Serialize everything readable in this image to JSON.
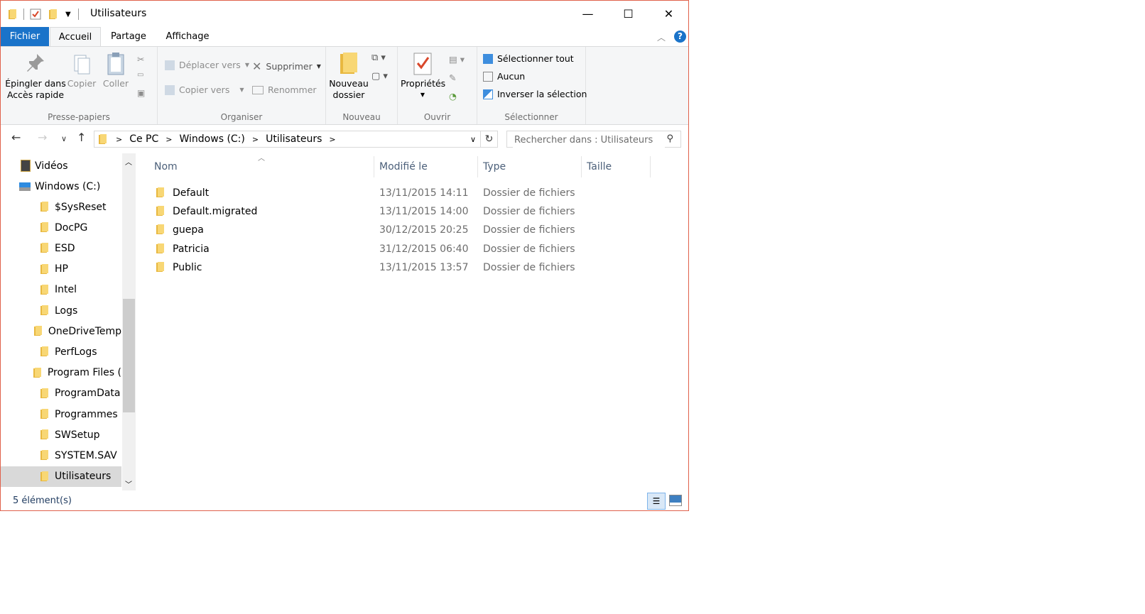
{
  "window": {
    "title": "Utilisateurs",
    "controls": {
      "minimize": "—",
      "maximize": "☐",
      "close": "✕"
    }
  },
  "tabs": [
    {
      "label": "Fichier"
    },
    {
      "label": "Accueil"
    },
    {
      "label": "Partage"
    },
    {
      "label": "Affichage"
    }
  ],
  "help_label": "?",
  "ribbon": {
    "clipboard": {
      "pin_label_1": "Épingler dans",
      "pin_label_2": "Accès rapide",
      "copy_label": "Copier",
      "paste_label": "Coller",
      "group_label": "Presse-papiers"
    },
    "organize": {
      "move_label": "Déplacer vers",
      "copy_to_label": "Copier vers",
      "delete_label": "Supprimer",
      "rename_label": "Renommer",
      "group_label": "Organiser"
    },
    "new": {
      "new_folder_1": "Nouveau",
      "new_folder_2": "dossier",
      "group_label": "Nouveau"
    },
    "open": {
      "properties_label": "Propriétés",
      "group_label": "Ouvrir"
    },
    "select": {
      "select_all": "Sélectionner tout",
      "none": "Aucun",
      "invert": "Inverser la sélection",
      "group_label": "Sélectionner"
    }
  },
  "address": {
    "path": [
      "Ce PC",
      "Windows (C:)",
      "Utilisateurs"
    ],
    "search_placeholder": "Rechercher dans : Utilisateurs"
  },
  "nav": {
    "items": [
      {
        "label": "Vidéos"
      },
      {
        "label": "Windows (C:)"
      },
      {
        "label": "$SysReset"
      },
      {
        "label": "DocPG"
      },
      {
        "label": "ESD"
      },
      {
        "label": "HP"
      },
      {
        "label": "Intel"
      },
      {
        "label": "Logs"
      },
      {
        "label": "OneDriveTemp"
      },
      {
        "label": "PerfLogs"
      },
      {
        "label": "Program Files ("
      },
      {
        "label": "ProgramData"
      },
      {
        "label": "Programmes"
      },
      {
        "label": "SWSetup"
      },
      {
        "label": "SYSTEM.SAV"
      },
      {
        "label": "Utilisateurs"
      }
    ]
  },
  "columns": {
    "name": "Nom",
    "modified": "Modifié le",
    "type": "Type",
    "size": "Taille"
  },
  "files": [
    {
      "name": "Default",
      "modified": "13/11/2015 14:11",
      "type": "Dossier de fichiers"
    },
    {
      "name": "Default.migrated",
      "modified": "13/11/2015 14:00",
      "type": "Dossier de fichiers"
    },
    {
      "name": "guepa",
      "modified": "30/12/2015 20:25",
      "type": "Dossier de fichiers"
    },
    {
      "name": "Patricia",
      "modified": "31/12/2015 06:40",
      "type": "Dossier de fichiers"
    },
    {
      "name": "Public",
      "modified": "13/11/2015 13:57",
      "type": "Dossier de fichiers"
    }
  ],
  "status": {
    "count": "5 élément(s)"
  },
  "colors": {
    "accent": "#1a73c9",
    "folder": "#f8d775",
    "border": "#e0614b"
  }
}
